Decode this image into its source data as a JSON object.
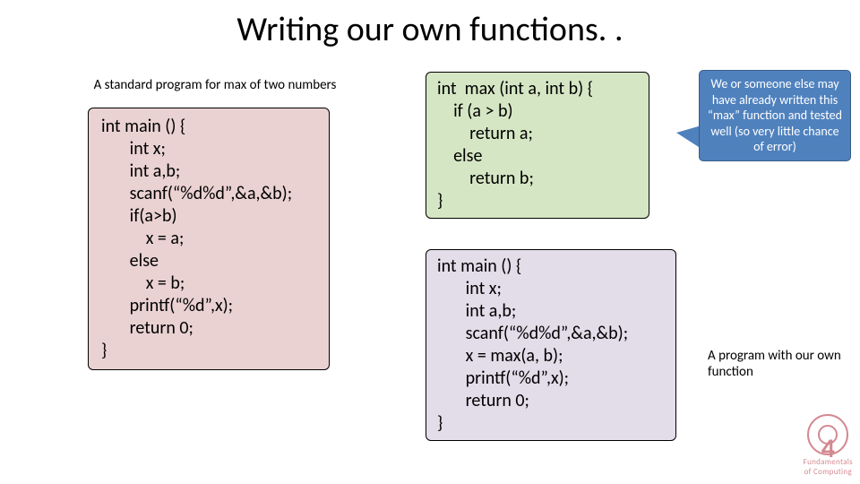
{
  "title": "Writing our own functions. .",
  "left_caption": "A standard program for max of two numbers",
  "left_code": "int main () {\n       int x;\n       int a,b;\n       scanf(“%d%d”,&a,&b);\n       if(a>b)\n           x = a;\n       else\n           x = b;\n       printf(“%d”,x);\n       return 0;\n}",
  "right_code_top": "int  max (int a, int b) {\n    if (a > b)\n        return a;\n    else\n        return b;\n}",
  "right_code_bottom": "int main () {\n       int x;\n       int a,b;\n       scanf(“%d%d”,&a,&b);\n       x = max(a, b);\n       printf(“%d”,x);\n       return 0;\n}",
  "callout": "We or someone else may have already written this “max” function and tested well (so very little chance of error)",
  "right_caption": "A program with our own function",
  "corner": {
    "num": "4",
    "text1": "Fundamentals",
    "text2": "of Computing"
  }
}
